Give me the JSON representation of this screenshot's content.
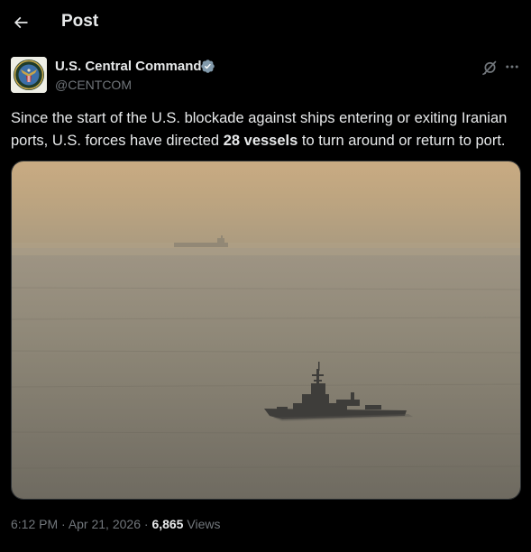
{
  "header": {
    "title": "Post",
    "back_icon": "arrow-left-icon"
  },
  "author": {
    "name": "U.S. Central Command",
    "handle": "@CENTCOM",
    "verified_color": "#829aab",
    "avatar_icon": "centcom-seal-icon"
  },
  "actions": {
    "grok_icon": "grok-icon",
    "more_icon": "more-horizontal-icon"
  },
  "tweet": {
    "text_before": "Since the start of the U.S. blockade against ships entering or exiting Iranian ports, U.S. forces have directed ",
    "text_bold": "28 vessels",
    "text_after": " to turn around or return to port."
  },
  "media": {
    "description_icon": "photo-warship-at-sea"
  },
  "meta": {
    "time": "6:12 PM",
    "separator1": " · ",
    "date": "Apr 21, 2026",
    "separator2": " · ",
    "views_count": "6,865",
    "views_label": " Views"
  },
  "colors": {
    "background": "#000000",
    "text_primary": "#e7e9ea",
    "text_secondary": "#71767b",
    "border": "#2f3336"
  }
}
